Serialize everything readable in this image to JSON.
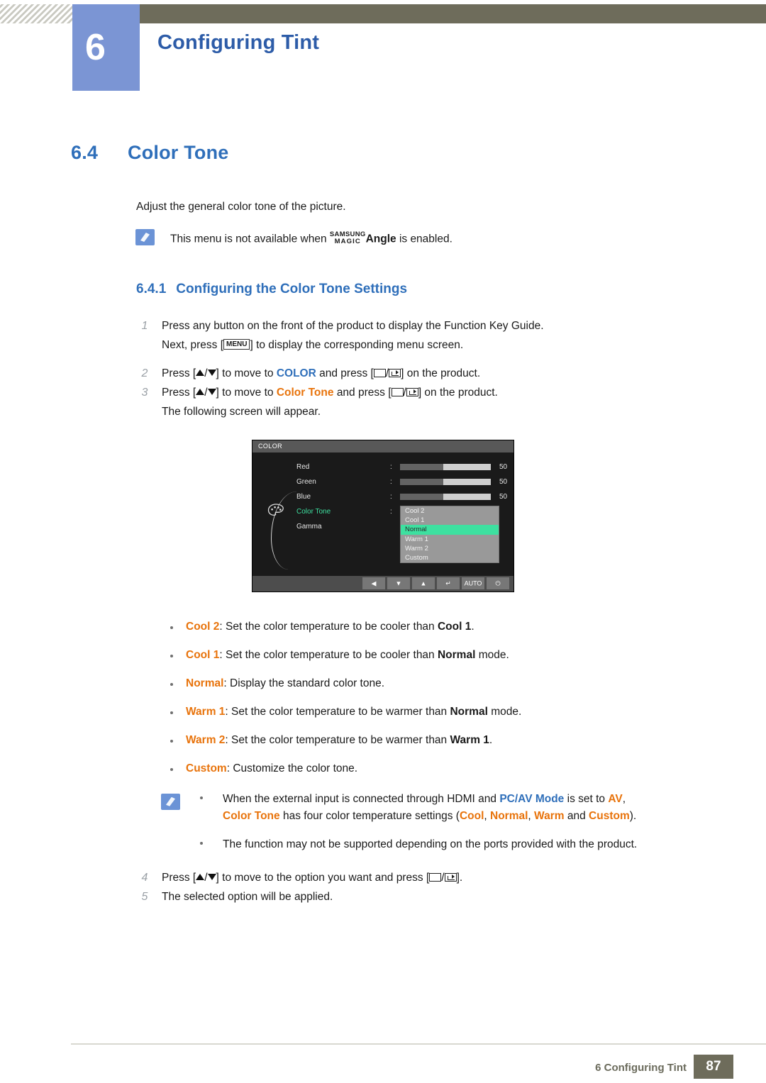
{
  "header": {
    "chapter_number": "6",
    "chapter_title": "Configuring Tint"
  },
  "section": {
    "number": "6.4",
    "title": "Color Tone",
    "intro": "Adjust the general color tone of the picture.",
    "note": {
      "prefix": "This menu is not available when",
      "magic_line1": "SAMSUNG",
      "magic_line2": "MAGIC",
      "magic_word": "Angle",
      "suffix": "is enabled."
    }
  },
  "subsection": {
    "number": "6.4.1",
    "title": "Configuring the Color Tone Settings"
  },
  "steps": [
    {
      "num": "1",
      "text": "Press any button on the front of the product to display the Function Key Guide.",
      "sub": {
        "pre": "Next, press [",
        "key": "MENU",
        "post": "] to display the corresponding menu screen."
      }
    },
    {
      "num": "2",
      "pre": "Press [",
      "mid": "] to move to",
      "target": "COLOR",
      "post_pre": "and press [",
      "post": "] on the product."
    },
    {
      "num": "3",
      "pre": "Press [",
      "mid": "] to move to",
      "target": "Color Tone",
      "post_pre": "and press [",
      "post": "] on the product.",
      "sub_text": "The following screen will appear."
    },
    {
      "num": "4",
      "pre": "Press [",
      "mid": "] to move to the option you want and press [",
      "post": "]."
    },
    {
      "num": "5",
      "text": "The selected option will be applied."
    }
  ],
  "osd": {
    "title": "COLOR",
    "rows": [
      {
        "label": "Red",
        "value": "50",
        "fill": 48
      },
      {
        "label": "Green",
        "value": "50",
        "fill": 48
      },
      {
        "label": "Blue",
        "value": "50",
        "fill": 48
      },
      {
        "label": "Color Tone",
        "value": "",
        "fill": 0,
        "selected": true
      },
      {
        "label": "Gamma",
        "value": "",
        "fill": 0
      }
    ],
    "dropdown": {
      "items": [
        "Cool 2",
        "Cool 1",
        "Normal",
        "Warm 1",
        "Warm 2",
        "Custom"
      ],
      "active": "Normal"
    },
    "footer_buttons": [
      "left-arrow",
      "down-arrow",
      "up-arrow",
      "enter",
      "AUTO",
      "power"
    ]
  },
  "bullets": [
    {
      "term": "Cool 2",
      "sep": ": ",
      "text_before": "Set the color temperature to be cooler than ",
      "strong": "Cool 1",
      "text_after": "."
    },
    {
      "term": "Cool 1",
      "sep": ": ",
      "text_before": "Set the color temperature to be cooler than ",
      "strong": "Normal",
      "text_after": " mode."
    },
    {
      "term": "Normal",
      "sep": ": ",
      "text_before": "Display the standard color tone.",
      "strong": "",
      "text_after": ""
    },
    {
      "term": "Warm 1",
      "sep": ": ",
      "text_before": "Set the color temperature to be warmer than ",
      "strong": "Normal",
      "text_after": " mode."
    },
    {
      "term": "Warm 2",
      "sep": ": ",
      "text_before": "Set the color temperature to be warmer than ",
      "strong": "Warm 1",
      "text_after": "."
    },
    {
      "term": "Custom",
      "sep": ": ",
      "text_before": "Customize the color tone.",
      "strong": "",
      "text_after": ""
    }
  ],
  "notebox": {
    "item1": {
      "p1": "When the external input is connected through HDMI and ",
      "b1": "PC/AV Mode",
      "p2": " is set to ",
      "b2": "AV",
      "p3": ",",
      "l2_b1": "Color Tone",
      "l2_p1": " has four color temperature settings (",
      "l2_b2": "Cool",
      "l2_p2": ", ",
      "l2_b3": "Normal",
      "l2_p3": ", ",
      "l2_b4": "Warm",
      "l2_p4": " and ",
      "l2_b5": "Custom",
      "l2_p5": ")."
    },
    "item2": "The function may not be supported depending on the ports provided with the product."
  },
  "footer": {
    "text": "6 Configuring Tint",
    "page": "87"
  },
  "colors": {
    "accent_blue": "#2f6fba",
    "badge_blue": "#7b95d4",
    "header_olive": "#6e6c5b",
    "orange": "#e8730b",
    "osd_green": "#3ee0a0"
  }
}
